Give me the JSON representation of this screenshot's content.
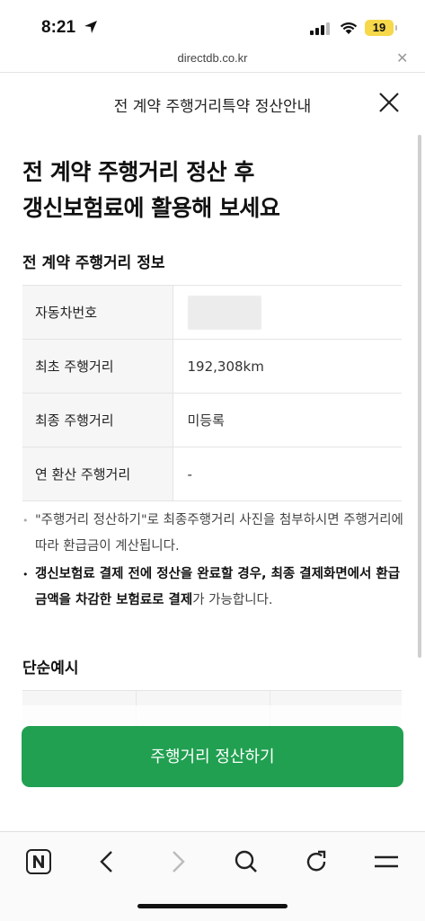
{
  "status_bar": {
    "time": "8:21",
    "battery": "19"
  },
  "browser": {
    "url": "directdb.co.kr"
  },
  "modal": {
    "title": "전 계약 주행거리특약 정산안내"
  },
  "headline": {
    "line1": "전 계약 주행거리 정산 후",
    "line2": "갱신보험료에 활용해 보세요"
  },
  "info_section": {
    "title": "전 계약 주행거리 정보",
    "rows": [
      {
        "label": "자동차번호",
        "value": ""
      },
      {
        "label": "최초 주행거리",
        "value": "192,308km"
      },
      {
        "label": "최종 주행거리",
        "value": "미등록"
      },
      {
        "label": "연 환산 주행거리",
        "value": "-"
      }
    ]
  },
  "notes": {
    "n1": "\"주행거리 정산하기\"로 최종주행거리 사진을 첨부하시면 주행거리에 따라 환급금이 계산됩니다.",
    "n2_bold1": "갱신보험료 결제 전에 정산을 완료할 경우, 최종 결제화면에서 환급금액을 차감한 보험료로 결제",
    "n2_rest": "가 가능합니다."
  },
  "example_section": {
    "title": "단순예시"
  },
  "cta": {
    "label": "주행거리 정산하기"
  },
  "colors": {
    "primary": "#20a050",
    "table_label_bg": "#f6f6f6"
  },
  "icons": [
    "location-arrow-icon",
    "signal-icon",
    "wifi-icon",
    "battery-icon",
    "close-icon",
    "naver-home-icon",
    "back-icon",
    "forward-icon",
    "search-icon",
    "refresh-icon",
    "menu-icon"
  ]
}
